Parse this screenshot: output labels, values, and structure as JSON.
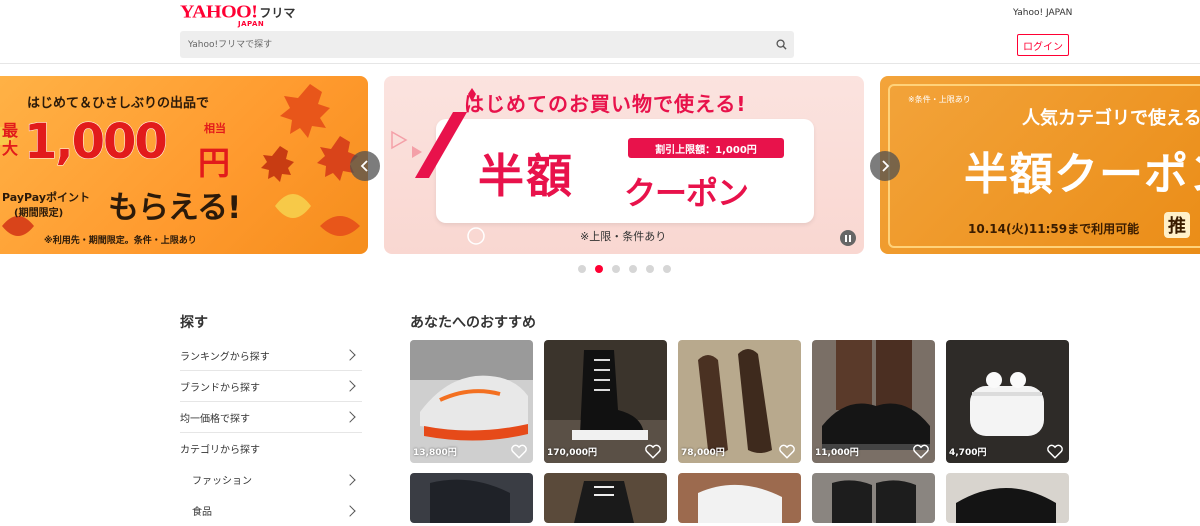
{
  "header": {
    "logo_text": "YAHOO!",
    "logo_sub": "JAPAN",
    "service_name": "フリマ",
    "top_link": "Yahoo! JAPAN",
    "search_placeholder": "Yahoo!フリマで探す",
    "login_label": "ログイン"
  },
  "carousel": {
    "banner1": {
      "top": "はじめて＆ひさしぶりの出品で",
      "max": "最大",
      "amount": "1,000",
      "yen": "円",
      "soutou": "相当",
      "paypay": "PayPayポイント",
      "period": "(期間限定)",
      "morae": "もらえる!",
      "note": "※利用先・期間限定。条件・上限あり"
    },
    "banner2": {
      "top": "はじめてのお買い物で使える!",
      "main": "半額",
      "coupon": "クーポン",
      "limit": "割引上限額：1,000円",
      "note": "※上限・条件あり"
    },
    "banner3": {
      "small": "※条件・上限あり",
      "top": "人気カテゴリで使える",
      "main": "半額クーポン",
      "date": "10.14(火)11:59まで利用可能",
      "badge": "推"
    },
    "dots_count": 6,
    "active_dot": 1
  },
  "sidebar": {
    "title": "探す",
    "items": [
      {
        "label": "ランキングから探す"
      },
      {
        "label": "ブランドから探す"
      },
      {
        "label": "均一価格で探す"
      },
      {
        "label": "カテゴリから探す"
      }
    ],
    "sub_items": [
      {
        "label": "ファッション"
      },
      {
        "label": "食品"
      }
    ]
  },
  "recommend": {
    "title": "あなたへのおすすめ",
    "products": [
      {
        "price": "13,800円",
        "bg": "#c9c9c9"
      },
      {
        "price": "170,000円",
        "bg": "#3a3228"
      },
      {
        "price": "78,000円",
        "bg": "#b5a58a"
      },
      {
        "price": "11,000円",
        "bg": "#6d6b6a"
      },
      {
        "price": "4,700円",
        "bg": "#2c2a28"
      }
    ]
  }
}
